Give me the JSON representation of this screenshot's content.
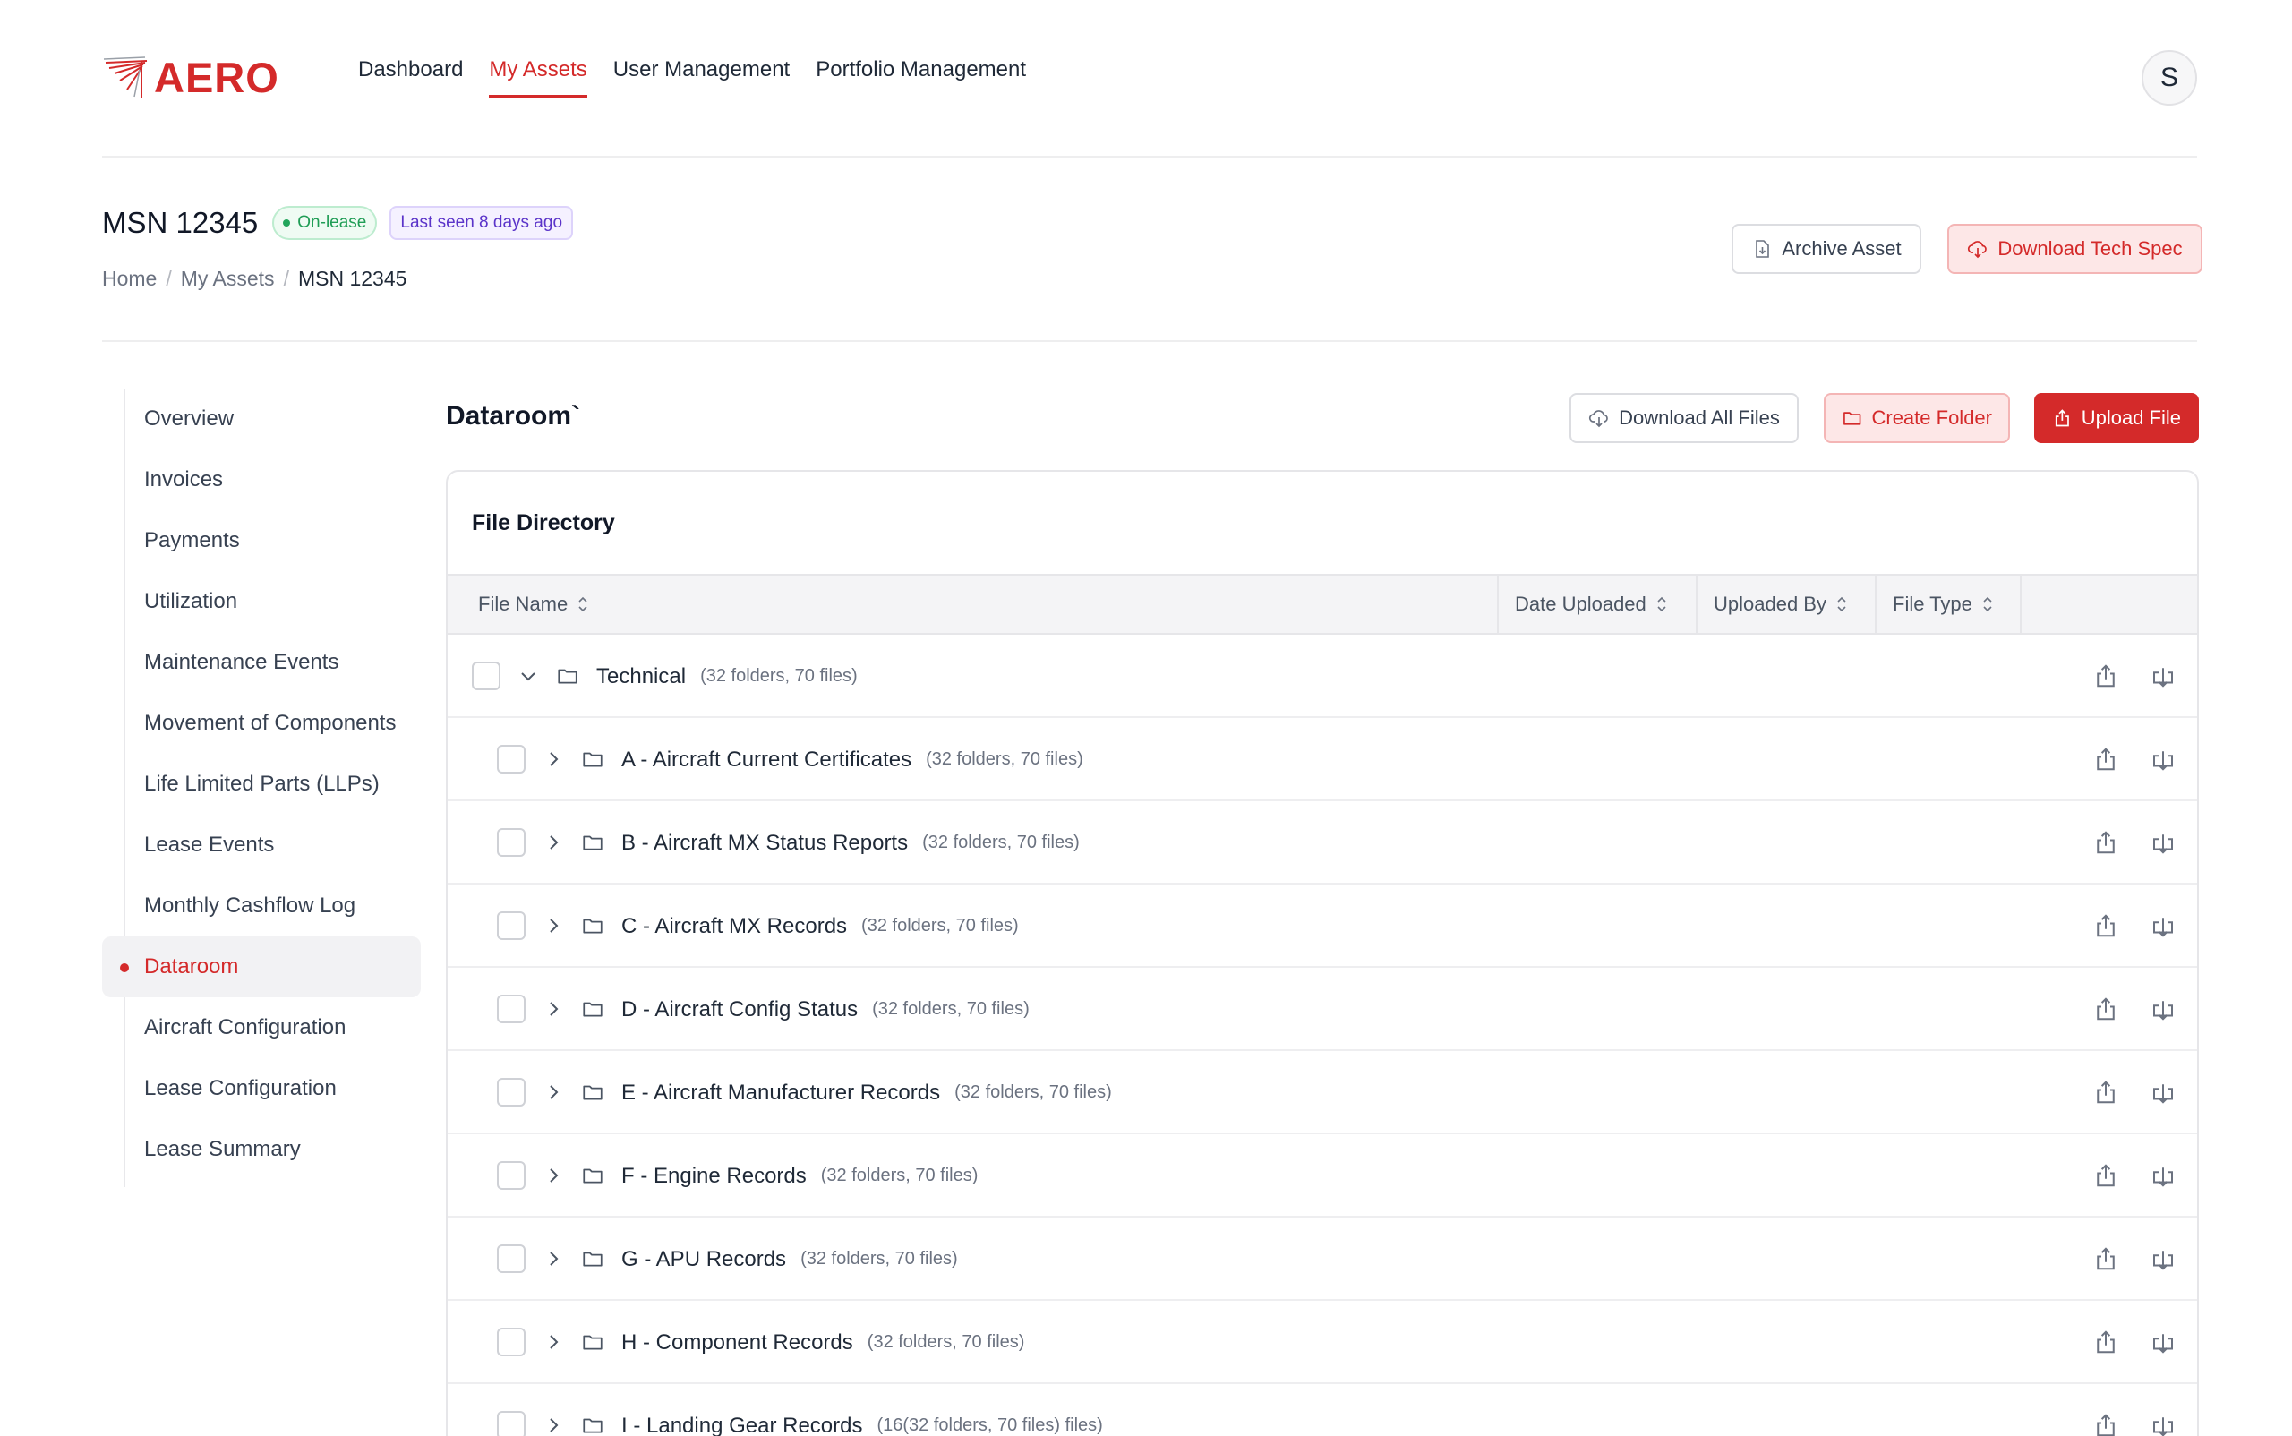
{
  "brand": {
    "name": "AERO",
    "color": "#d42a2a"
  },
  "nav": {
    "items": [
      {
        "label": "Dashboard",
        "active": false
      },
      {
        "label": "My Assets",
        "active": true
      },
      {
        "label": "User Management",
        "active": false
      },
      {
        "label": "Portfolio Management",
        "active": false
      }
    ]
  },
  "user": {
    "initial": "S"
  },
  "asset": {
    "title": "MSN 12345",
    "status_badge": "On-lease",
    "last_seen_badge": "Last seen 8 days ago",
    "breadcrumb": [
      "Home",
      "My Assets",
      "MSN 12345"
    ],
    "archive_label": "Archive Asset",
    "tech_spec_label": "Download Tech Spec"
  },
  "sidebar": {
    "items": [
      {
        "label": "Overview",
        "active": false
      },
      {
        "label": "Invoices",
        "active": false
      },
      {
        "label": "Payments",
        "active": false
      },
      {
        "label": "Utilization",
        "active": false
      },
      {
        "label": "Maintenance Events",
        "active": false
      },
      {
        "label": "Movement of Components",
        "active": false
      },
      {
        "label": "Life Limited Parts (LLPs)",
        "active": false
      },
      {
        "label": "Lease Events",
        "active": false
      },
      {
        "label": "Monthly Cashflow Log",
        "active": false
      },
      {
        "label": "Dataroom",
        "active": true
      },
      {
        "label": "Aircraft Configuration",
        "active": false
      },
      {
        "label": "Lease Configuration",
        "active": false
      },
      {
        "label": "Lease Summary",
        "active": false
      }
    ]
  },
  "dataroom": {
    "title": "Dataroom`",
    "download_all_label": "Download All Files",
    "create_folder_label": "Create Folder",
    "upload_label": "Upload File",
    "directory_title": "File Directory",
    "columns": [
      "File Name",
      "Date Uploaded",
      "Uploaded By",
      "File Type"
    ],
    "rows": [
      {
        "name": "Technical",
        "meta": "(32 folders, 70 files)",
        "level": 0,
        "expanded": true
      },
      {
        "name": "A - Aircraft Current Certificates",
        "meta": "(32 folders, 70 files)",
        "level": 1,
        "expanded": false
      },
      {
        "name": "B - Aircraft MX Status Reports",
        "meta": "(32 folders, 70 files)",
        "level": 1,
        "expanded": false
      },
      {
        "name": "C - Aircraft MX Records",
        "meta": "(32 folders, 70 files)",
        "level": 1,
        "expanded": false
      },
      {
        "name": "D - Aircraft Config Status",
        "meta": "(32 folders, 70 files)",
        "level": 1,
        "expanded": false
      },
      {
        "name": "E - Aircraft Manufacturer Records",
        "meta": "(32 folders, 70 files)",
        "level": 1,
        "expanded": false
      },
      {
        "name": "F - Engine Records",
        "meta": "(32 folders, 70 files)",
        "level": 1,
        "expanded": false
      },
      {
        "name": "G - APU Records",
        "meta": "(32 folders, 70 files)",
        "level": 1,
        "expanded": false
      },
      {
        "name": "H - Component Records",
        "meta": "(32 folders, 70 files)",
        "level": 1,
        "expanded": false
      },
      {
        "name": "I - Landing Gear Records",
        "meta": "(16(32 folders, 70 files) files)",
        "level": 1,
        "expanded": false
      }
    ]
  },
  "icons": {
    "sort": "sort-icon",
    "folder": "folder-icon",
    "upload": "upload-icon",
    "download": "download-icon",
    "chevron_down": "chevron-down-icon",
    "chevron_right": "chevron-right-icon"
  },
  "colors": {
    "accent": "#d42a2a",
    "success": "#1f9d55",
    "badge_purple": "#5b34c9"
  }
}
